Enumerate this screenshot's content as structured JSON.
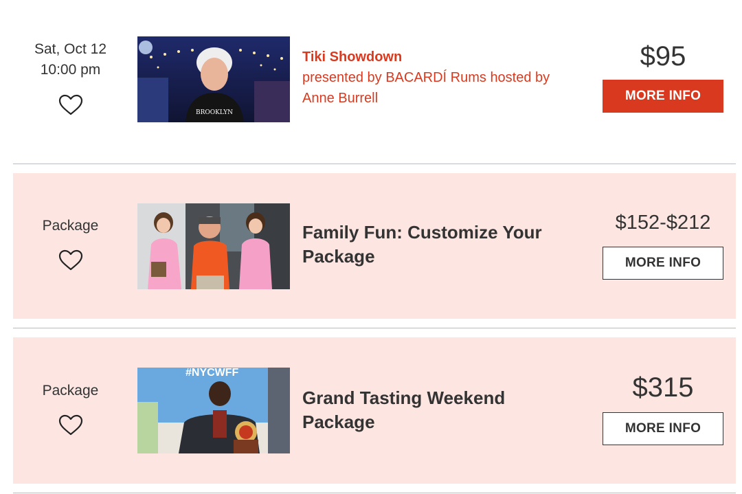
{
  "events": [
    {
      "date_line1": "Sat, Oct 12",
      "date_line2": "10:00 pm",
      "title": "Tiki Showdown",
      "subtitle_line1": "presented by BACARDÍ Rums hosted by",
      "subtitle_line2": "Anne Burrell",
      "price": "$95",
      "button_label": "MORE INFO",
      "image_icon": "chef-photo"
    },
    {
      "label": "Package",
      "title_line1": "Family Fun: Customize Your",
      "title_line2": "Package",
      "price": "$152-$212",
      "button_label": "MORE INFO",
      "image_icon": "family-photo"
    },
    {
      "label": "Package",
      "title_line1": "Grand Tasting Weekend",
      "title_line2": "Package",
      "price": "$315",
      "button_label": "MORE INFO",
      "image_icon": "chef-photo",
      "image_text": "#NYCWFF"
    }
  ],
  "colors": {
    "accent": "#d93a1f",
    "pink_row": "#fde6e2",
    "divider": "#b8bcc0",
    "text": "#333333"
  }
}
